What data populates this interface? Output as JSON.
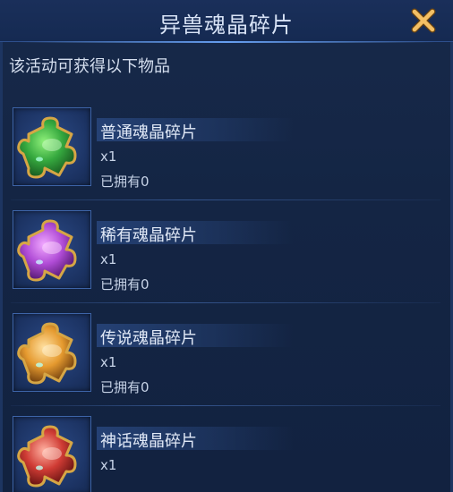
{
  "dialog": {
    "title": "异兽魂晶碎片",
    "subtitle": "该活动可获得以下物品",
    "close_icon": "close-x-icon",
    "accent_color": "#f0b65a"
  },
  "items": [
    {
      "name": "普通魂晶碎片",
      "quantity": "x1",
      "owned": "已拥有0",
      "icon": "green-puzzle-piece-icon",
      "color": "#3fb14a"
    },
    {
      "name": "稀有魂晶碎片",
      "quantity": "x1",
      "owned": "已拥有0",
      "icon": "purple-puzzle-piece-icon",
      "color": "#b04cd6"
    },
    {
      "name": "传说魂晶碎片",
      "quantity": "x1",
      "owned": "已拥有0",
      "icon": "orange-puzzle-piece-icon",
      "color": "#e59a2f"
    },
    {
      "name": "神话魂晶碎片",
      "quantity": "x1",
      "owned": "",
      "icon": "red-puzzle-piece-icon",
      "color": "#cf3b34"
    }
  ]
}
